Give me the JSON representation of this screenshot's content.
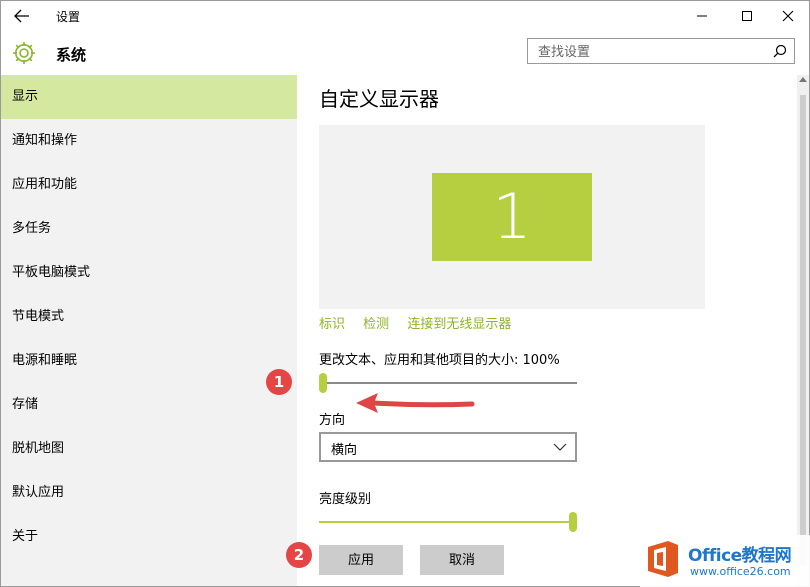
{
  "window": {
    "title": "设置",
    "colors": {
      "accent": "#b5cf41",
      "sidebar_active": "#d5e8a0",
      "sidebar_bg": "#f2f2f2",
      "link": "#8db42a"
    }
  },
  "header": {
    "section_title": "系统",
    "search_placeholder": "查找设置"
  },
  "sidebar": {
    "items": [
      {
        "label": "显示",
        "active": true
      },
      {
        "label": "通知和操作"
      },
      {
        "label": "应用和功能"
      },
      {
        "label": "多任务"
      },
      {
        "label": "平板电脑模式"
      },
      {
        "label": "节电模式"
      },
      {
        "label": "电源和睡眠"
      },
      {
        "label": "存储"
      },
      {
        "label": "脱机地图"
      },
      {
        "label": "默认应用"
      },
      {
        "label": "关于"
      }
    ]
  },
  "main": {
    "title": "自定义显示器",
    "monitor_label": "1",
    "links": [
      "标识",
      "检测",
      "连接到无线显示器"
    ],
    "scale_label": "更改文本、应用和其他项目的大小: 100%",
    "scale_value_fraction": 0.0,
    "orientation_label": "方向",
    "orientation_value": "横向",
    "brightness_label": "亮度级别",
    "brightness_value_fraction": 1.0,
    "apply_label": "应用",
    "cancel_label": "取消"
  },
  "annotations": {
    "badge_1": "1",
    "badge_2": "2"
  },
  "watermark": {
    "title": "Office教程网",
    "url": "www.office26.com"
  }
}
